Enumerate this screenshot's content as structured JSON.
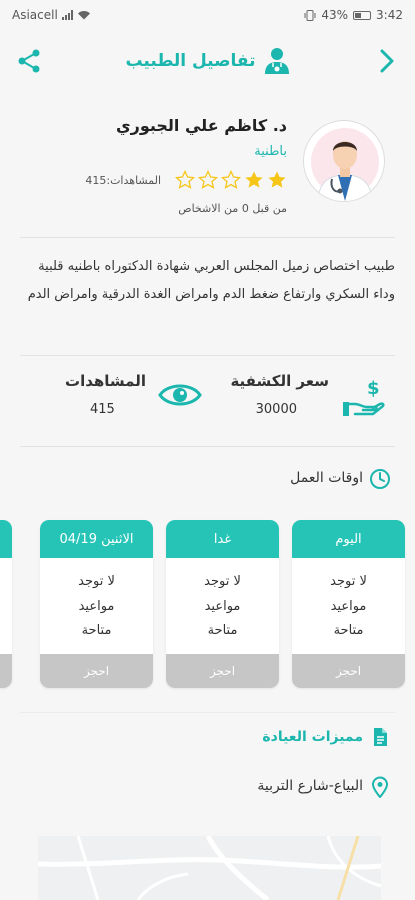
{
  "status_bar": {
    "carrier": "Asiacell",
    "battery": "43%",
    "time": "3:42"
  },
  "header": {
    "title": "تفاصيل الطبيب"
  },
  "doctor": {
    "name": "د. كاظم علي الجبوري",
    "specialty": "باطنية",
    "rating": 2,
    "rating_max": 5,
    "views_inline": "المشاهدات:415",
    "rating_note": "من قبل 0 من الاشخاص"
  },
  "about": "طبيب اختصاص زميل المجلس العربي شهادة الدكتوراه باطنيه قلبية وداء السكري وارتفاع ضغط الدم وامراض الغدة الدرقية وامراض الدم",
  "stats": {
    "fee_label": "سعر الكشفية",
    "fee_value": "30000",
    "views_label": "المشاهدات",
    "views_value": "415"
  },
  "work_hours": {
    "title": "اوقات العمل",
    "days": [
      {
        "label": "اليوم",
        "line1": "لا توجد",
        "line2": "مواعيد",
        "line3": "متاحة",
        "book": "احجز"
      },
      {
        "label": "غدا",
        "line1": "لا توجد",
        "line2": "مواعيد",
        "line3": "متاحة",
        "book": "احجز"
      },
      {
        "label": "الاثنين 04/19",
        "line1": "لا توجد",
        "line2": "مواعيد",
        "line3": "متاحة",
        "book": "احجز"
      }
    ]
  },
  "features": {
    "title": "مميزات العيادة"
  },
  "location": {
    "address": "البياع-شارع التربية"
  },
  "colors": {
    "accent": "#1bb6ad",
    "day_header": "#26c4b6",
    "book_disabled": "#c6c6c6",
    "star_filled": "#f5c518"
  },
  "icons": [
    "share-icon",
    "doctor-icon",
    "chevron-right-icon",
    "star-icon",
    "money-hand-icon",
    "eye-icon",
    "clock-icon",
    "document-icon",
    "location-pin-icon"
  ]
}
